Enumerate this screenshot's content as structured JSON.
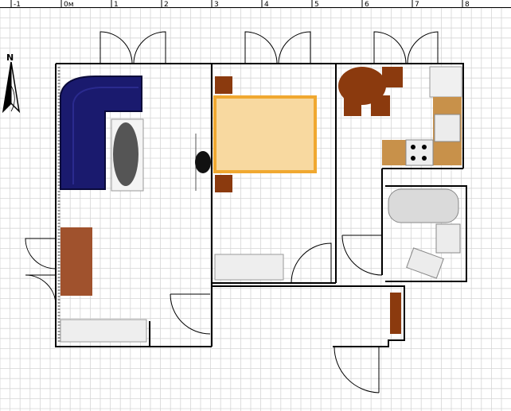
{
  "ruler": {
    "ticks": [
      "-1",
      "0м",
      "1",
      "2",
      "3",
      "4",
      "5",
      "6",
      "7",
      "8"
    ]
  },
  "compass": {
    "label": "N"
  },
  "colors": {
    "canvas_bg": "#ffffff",
    "grid_minor": "#d6d6d6",
    "grid_major": "#9a9a9a",
    "wall": "#000000",
    "sofa": "#1a1a6e",
    "bed": "#f8d9a0",
    "bed_border": "#f0a830",
    "furniture_brown": "#8b3a0e",
    "desk": "#a0522d",
    "counter": "#c8914a",
    "fixture": "#e8e8e8"
  },
  "furniture": [
    "corner-sofa",
    "oval-rug",
    "desk",
    "radiator",
    "bed",
    "nightstand-top",
    "nightstand-bottom",
    "floor-lamp",
    "round-dining-table",
    "dining-chair",
    "fridge",
    "kitchen-sink",
    "stove",
    "kitchen-counter",
    "bathtub",
    "bathroom-sink",
    "toilet",
    "wardrobe",
    "shoe-cabinet",
    "bedroom-radiator"
  ]
}
